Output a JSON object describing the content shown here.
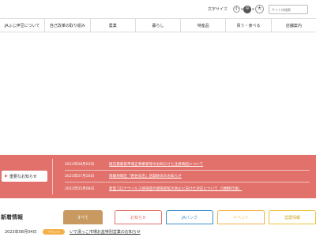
{
  "header": {
    "font_size_label": "文字サイズ",
    "font_sizes": [
      "小",
      "中",
      "大"
    ],
    "search_placeholder": "サイト内検索"
  },
  "nav": {
    "items": [
      "JAふじ伊豆について",
      "自己改革の取り組み",
      "農業",
      "暮らし",
      "特産品",
      "買う・食べる",
      "店舗案内"
    ]
  },
  "notice": {
    "button_label": "重要なお知らせ",
    "items": [
      {
        "date": "2023年08月03日",
        "title": "経営農薬基準適正事業者等のお知らせと注意喚起について"
      },
      {
        "date": "2023年07月28日",
        "title": "南駿地域区「岩谷支店」店舗除去のお知らせ"
      },
      {
        "date": "2023年05月08日",
        "title": "新型コロナウイルス感染症の感染症拡大防止に向けた対応について（5類移行後）"
      }
    ]
  },
  "news": {
    "title": "新着情報",
    "tabs": [
      "すべて",
      "お知らせ",
      "JAバンク",
      "イベント",
      "営農情報"
    ],
    "items": [
      {
        "date": "2023年08月04日",
        "badge": "イベント",
        "title": "いで湯っこ市場お盆特別営業のお知らせ"
      }
    ]
  },
  "colors": {
    "notice_bg": "#e2716b",
    "tab_all": "#c89a62",
    "tab_notice": "#e2716b",
    "tab_bank": "#3f8fc7",
    "tab_event": "#f4b04a",
    "tab_agri": "#e8c33c",
    "badge_event": "#f4b04a"
  }
}
